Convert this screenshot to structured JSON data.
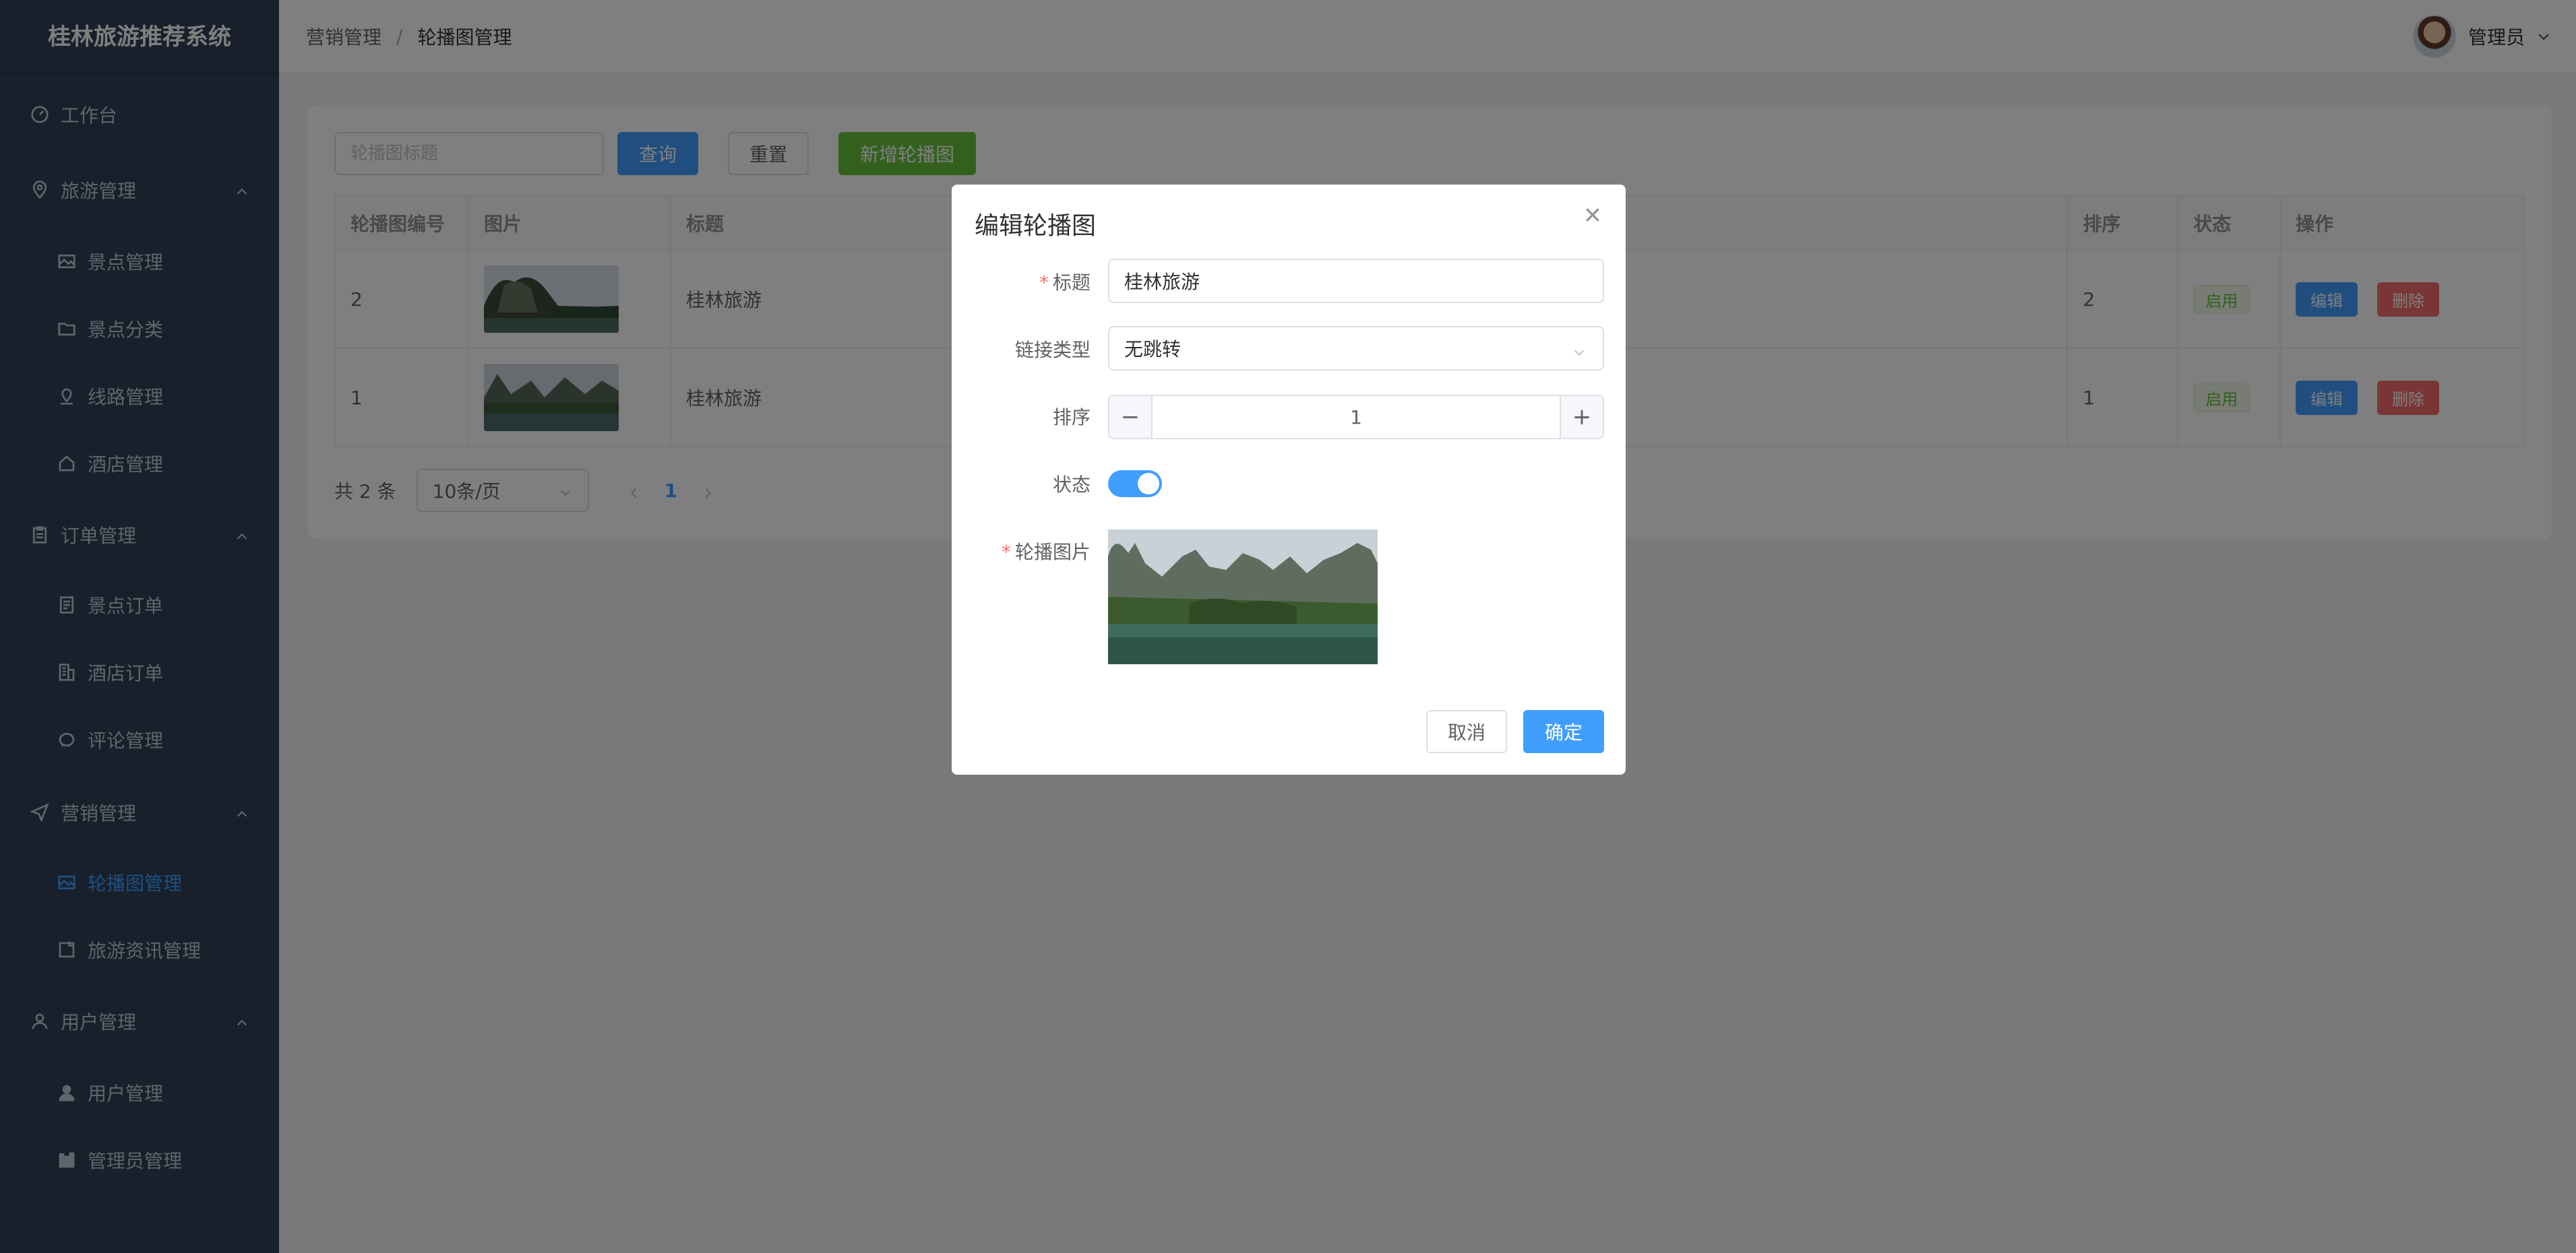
{
  "app": {
    "title": "桂林旅游推荐系统"
  },
  "sidebar": {
    "workbench": "工作台",
    "groups": [
      {
        "label": "旅游管理",
        "items": [
          "景点管理",
          "景点分类",
          "线路管理",
          "酒店管理"
        ]
      },
      {
        "label": "订单管理",
        "items": [
          "景点订单",
          "酒店订单",
          "评论管理"
        ]
      },
      {
        "label": "营销管理",
        "items": [
          "轮播图管理",
          "旅游资讯管理"
        ]
      },
      {
        "label": "用户管理",
        "items": [
          "用户管理",
          "管理员管理"
        ]
      }
    ],
    "active_item": "轮播图管理"
  },
  "header": {
    "breadcrumb": [
      "营销管理",
      "轮播图管理"
    ],
    "separator": "/",
    "user_name": "管理员"
  },
  "toolbar": {
    "search_placeholder": "轮播图标题",
    "query_label": "查询",
    "reset_label": "重置",
    "add_label": "新增轮播图"
  },
  "table": {
    "headers": [
      "轮播图编号",
      "图片",
      "标题",
      "",
      "排序",
      "状态",
      "操作"
    ],
    "rows": [
      {
        "id": "2",
        "title": "桂林旅游",
        "sort": "2",
        "status": "启用",
        "edit": "编辑",
        "delete": "删除"
      },
      {
        "id": "1",
        "title": "桂林旅游",
        "sort": "1",
        "status": "启用",
        "edit": "编辑",
        "delete": "删除"
      }
    ]
  },
  "pagination": {
    "total": "共 2 条",
    "page_size": "10条/页",
    "current": "1"
  },
  "dialog": {
    "title": "编辑轮播图",
    "fields": {
      "title_label": "标题",
      "title_value": "桂林旅游",
      "link_type_label": "链接类型",
      "link_type_value": "无跳转",
      "sort_label": "排序",
      "sort_value": "1",
      "status_label": "状态",
      "status_on": true,
      "image_label": "轮播图片"
    },
    "cancel_label": "取消",
    "confirm_label": "确定"
  },
  "colors": {
    "primary": "#409eff",
    "success": "#67c23a",
    "danger": "#f56c6c",
    "sidebar_bg": "#304156"
  }
}
